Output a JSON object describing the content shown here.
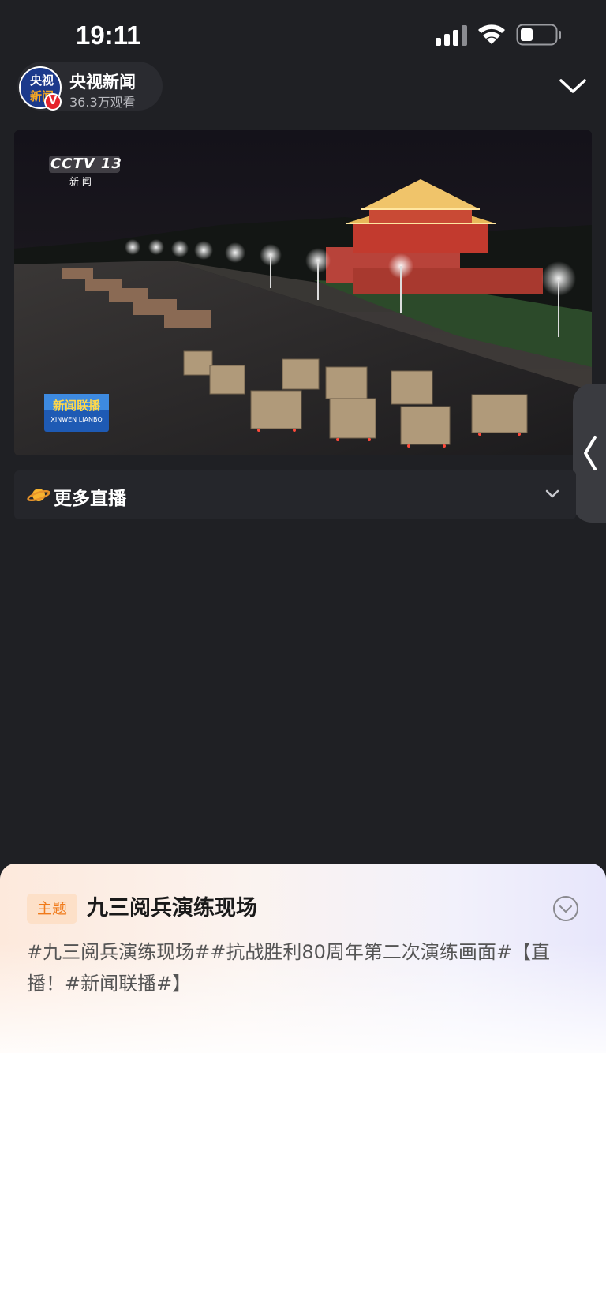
{
  "status_bar": {
    "time": "19:11"
  },
  "channel": {
    "name": "央视新闻",
    "views": "36.3万观看",
    "avatar_line1": "央视",
    "avatar_line2": "新闻",
    "verified_mark": "V"
  },
  "video": {
    "cctv_logo": "CCTV 13",
    "cctv_sub": "新 闻",
    "program_logo": "新闻联播",
    "program_logo_en": "XINWEN LIANBO"
  },
  "more_live": {
    "label": "更多直播"
  },
  "topic": {
    "badge": "主题",
    "title": "九三阅兵演练现场",
    "description": "#九三阅兵演练现场##抗战胜利80周年第二次演练画面#【直播！#新闻联播#】"
  },
  "colors": {
    "background": "#1f2024",
    "badge_bg": "#fde0c8",
    "badge_text": "#f07a1a",
    "verified": "#e5232c"
  }
}
